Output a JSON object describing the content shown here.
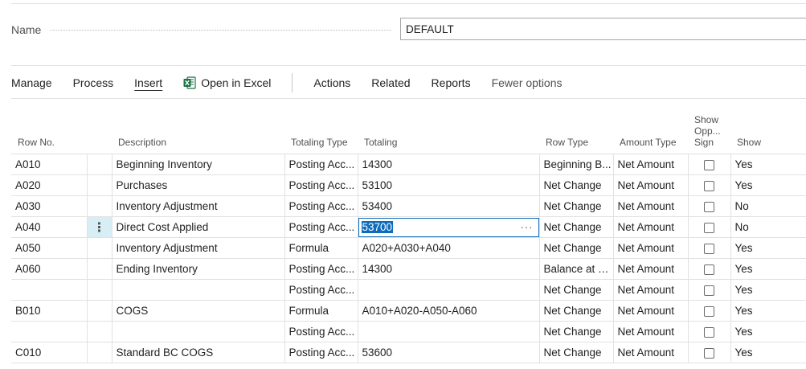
{
  "header": {
    "name_label": "Name",
    "name_value": "DEFAULT"
  },
  "actions": {
    "manage": "Manage",
    "process": "Process",
    "insert": "Insert",
    "open_in_excel": "Open in Excel",
    "actions": "Actions",
    "related": "Related",
    "reports": "Reports",
    "fewer_options": "Fewer options"
  },
  "icons": {
    "excel": "excel-icon",
    "row_menu": "vertical-ellipsis-icon",
    "lookup": "ellipsis-icon"
  },
  "table": {
    "headers": {
      "row_no": "Row No.",
      "description": "Description",
      "totaling_type": "Totaling Type",
      "totaling": "Totaling",
      "row_type": "Row Type",
      "amount_type": "Amount Type",
      "show_opp_sign": "Show Opp... Sign",
      "show": "Show"
    },
    "rows": [
      {
        "row_no": "A010",
        "description": "Beginning Inventory",
        "totaling_type": "Posting Acc...",
        "totaling": "14300",
        "row_type": "Beginning B...",
        "amount_type": "Net Amount",
        "show_opp_sign": false,
        "show": "Yes"
      },
      {
        "row_no": "A020",
        "description": "Purchases",
        "totaling_type": "Posting Acc...",
        "totaling": "53100",
        "row_type": "Net Change",
        "amount_type": "Net Amount",
        "show_opp_sign": false,
        "show": "Yes"
      },
      {
        "row_no": "A030",
        "description": "Inventory Adjustment",
        "totaling_type": "Posting Acc...",
        "totaling": "53400",
        "row_type": "Net Change",
        "amount_type": "Net Amount",
        "show_opp_sign": false,
        "show": "No"
      },
      {
        "row_no": "A040",
        "description": "Direct Cost Applied",
        "totaling_type": "Posting Acc...",
        "totaling": "53700",
        "row_type": "Net Change",
        "amount_type": "Net Amount",
        "show_opp_sign": false,
        "show": "No"
      },
      {
        "row_no": "A050",
        "description": "Inventory Adjustment",
        "totaling_type": "Formula",
        "totaling": "A020+A030+A040",
        "row_type": "Net Change",
        "amount_type": "Net Amount",
        "show_opp_sign": false,
        "show": "Yes"
      },
      {
        "row_no": "A060",
        "description": "Ending Inventory",
        "totaling_type": "Posting Acc...",
        "totaling": "14300",
        "row_type": "Balance at D...",
        "amount_type": "Net Amount",
        "show_opp_sign": false,
        "show": "Yes"
      },
      {
        "row_no": "",
        "description": "",
        "totaling_type": "Posting Acc...",
        "totaling": "",
        "row_type": "Net Change",
        "amount_type": "Net Amount",
        "show_opp_sign": false,
        "show": "Yes"
      },
      {
        "row_no": "B010",
        "description": "COGS",
        "totaling_type": "Formula",
        "totaling": "A010+A020-A050-A060",
        "row_type": "Net Change",
        "amount_type": "Net Amount",
        "show_opp_sign": false,
        "show": "Yes"
      },
      {
        "row_no": "",
        "description": "",
        "totaling_type": "Posting Acc...",
        "totaling": "",
        "row_type": "Net Change",
        "amount_type": "Net Amount",
        "show_opp_sign": false,
        "show": "Yes"
      },
      {
        "row_no": "C010",
        "description": "Standard BC COGS",
        "totaling_type": "Posting Acc...",
        "totaling": "53600",
        "row_type": "Net Change",
        "amount_type": "Net Amount",
        "show_opp_sign": false,
        "show": "Yes"
      }
    ],
    "active_row_index": 3,
    "lookup_glyph": "···",
    "row_menu_glyph": "⋮"
  }
}
